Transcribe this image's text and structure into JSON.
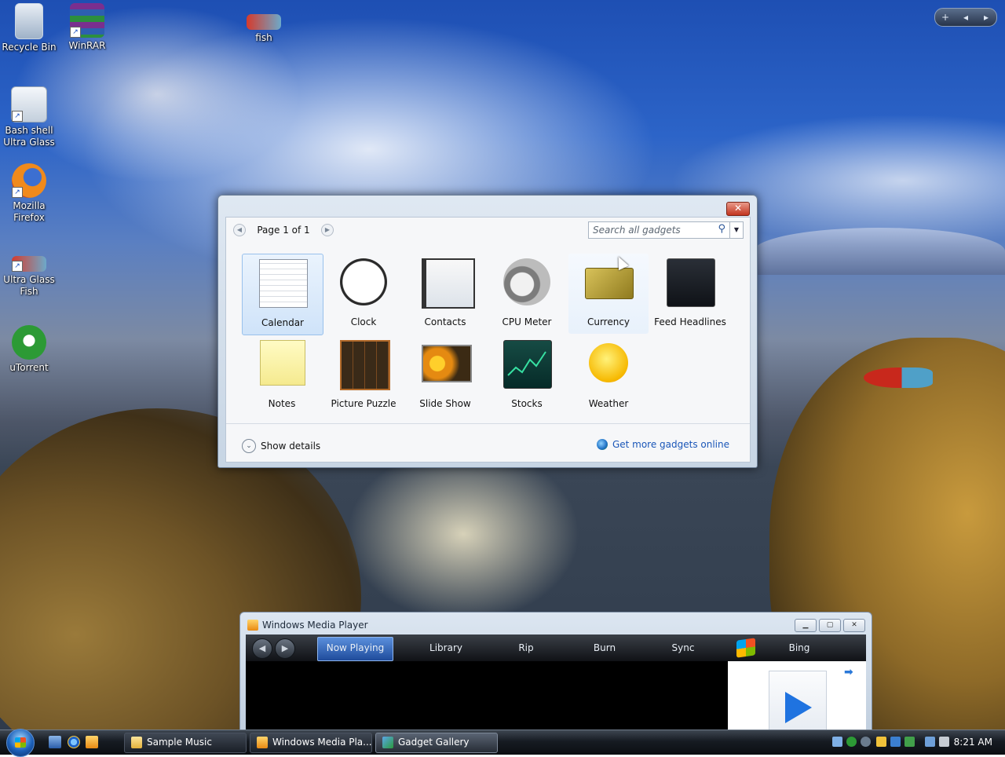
{
  "desktop": {
    "icons": [
      {
        "label": "Recycle Bin",
        "icon": "recycle-bin-icon"
      },
      {
        "label": "WinRAR",
        "icon": "winrar-icon"
      },
      {
        "label": "fish",
        "icon": "fish-icon"
      },
      {
        "label": "Bash shell Ultra Glass",
        "icon": "bash-shell-icon"
      },
      {
        "label": "Mozilla Firefox",
        "icon": "firefox-icon"
      },
      {
        "label": "Ultra Glass Fish",
        "icon": "fish-icon"
      },
      {
        "label": "uTorrent",
        "icon": "utorrent-icon"
      }
    ],
    "shortcut_glyph": "↗"
  },
  "sidebar_control": {
    "add": "+",
    "prev": "◂",
    "next": "▸"
  },
  "gadget_gallery": {
    "close_label": "✕",
    "pager": {
      "label": "Page 1 of 1",
      "prev": "◀",
      "next": "▶"
    },
    "search": {
      "placeholder": "Search all gadgets",
      "icon": "⚲",
      "dropdown": "▼"
    },
    "gadgets": [
      {
        "name": "Calendar",
        "selected": true
      },
      {
        "name": "Clock"
      },
      {
        "name": "Contacts"
      },
      {
        "name": "CPU Meter"
      },
      {
        "name": "Currency",
        "hover": true
      },
      {
        "name": "Feed Headlines"
      },
      {
        "name": "Notes"
      },
      {
        "name": "Picture Puzzle"
      },
      {
        "name": "Slide Show"
      },
      {
        "name": "Stocks"
      },
      {
        "name": "Weather"
      }
    ],
    "show_details": "Show details",
    "show_details_chevron": "⌄",
    "get_more": "Get more gadgets online"
  },
  "media_player": {
    "title": "Windows Media Player",
    "window_buttons": {
      "minimize": "▁",
      "maximize": "▢",
      "close": "✕"
    },
    "nav": {
      "back": "◀",
      "forward": "▶"
    },
    "tabs": [
      "Now Playing",
      "Library",
      "Rip",
      "Burn",
      "Sync",
      "Bing"
    ],
    "active_tab": "Now Playing",
    "side_arrow": "➡"
  },
  "taskbar": {
    "items": [
      {
        "label": "Sample Music",
        "active": false
      },
      {
        "label": "Windows Media Pla...",
        "active": false
      },
      {
        "label": "Gadget Gallery",
        "active": true
      }
    ],
    "clock": "8:21 AM"
  }
}
